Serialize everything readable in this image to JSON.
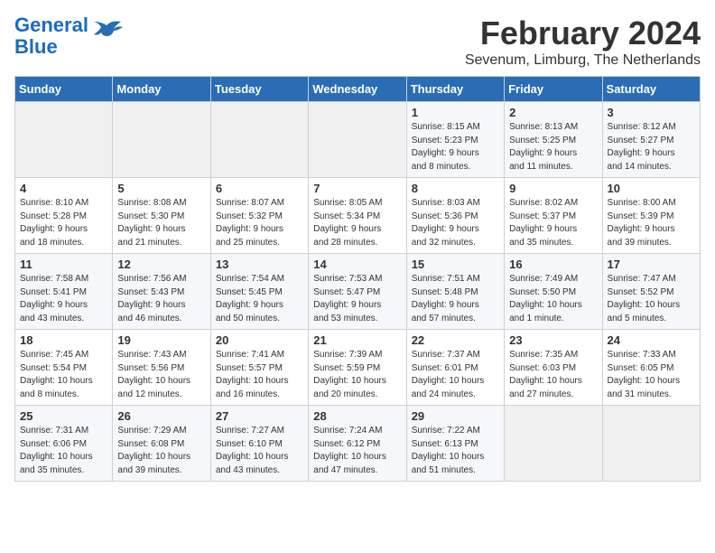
{
  "logo": {
    "part1": "General",
    "part2": "Blue"
  },
  "title": "February 2024",
  "location": "Sevenum, Limburg, The Netherlands",
  "days_of_week": [
    "Sunday",
    "Monday",
    "Tuesday",
    "Wednesday",
    "Thursday",
    "Friday",
    "Saturday"
  ],
  "weeks": [
    [
      {
        "day": "",
        "detail": ""
      },
      {
        "day": "",
        "detail": ""
      },
      {
        "day": "",
        "detail": ""
      },
      {
        "day": "",
        "detail": ""
      },
      {
        "day": "1",
        "detail": "Sunrise: 8:15 AM\nSunset: 5:23 PM\nDaylight: 9 hours\nand 8 minutes."
      },
      {
        "day": "2",
        "detail": "Sunrise: 8:13 AM\nSunset: 5:25 PM\nDaylight: 9 hours\nand 11 minutes."
      },
      {
        "day": "3",
        "detail": "Sunrise: 8:12 AM\nSunset: 5:27 PM\nDaylight: 9 hours\nand 14 minutes."
      }
    ],
    [
      {
        "day": "4",
        "detail": "Sunrise: 8:10 AM\nSunset: 5:28 PM\nDaylight: 9 hours\nand 18 minutes."
      },
      {
        "day": "5",
        "detail": "Sunrise: 8:08 AM\nSunset: 5:30 PM\nDaylight: 9 hours\nand 21 minutes."
      },
      {
        "day": "6",
        "detail": "Sunrise: 8:07 AM\nSunset: 5:32 PM\nDaylight: 9 hours\nand 25 minutes."
      },
      {
        "day": "7",
        "detail": "Sunrise: 8:05 AM\nSunset: 5:34 PM\nDaylight: 9 hours\nand 28 minutes."
      },
      {
        "day": "8",
        "detail": "Sunrise: 8:03 AM\nSunset: 5:36 PM\nDaylight: 9 hours\nand 32 minutes."
      },
      {
        "day": "9",
        "detail": "Sunrise: 8:02 AM\nSunset: 5:37 PM\nDaylight: 9 hours\nand 35 minutes."
      },
      {
        "day": "10",
        "detail": "Sunrise: 8:00 AM\nSunset: 5:39 PM\nDaylight: 9 hours\nand 39 minutes."
      }
    ],
    [
      {
        "day": "11",
        "detail": "Sunrise: 7:58 AM\nSunset: 5:41 PM\nDaylight: 9 hours\nand 43 minutes."
      },
      {
        "day": "12",
        "detail": "Sunrise: 7:56 AM\nSunset: 5:43 PM\nDaylight: 9 hours\nand 46 minutes."
      },
      {
        "day": "13",
        "detail": "Sunrise: 7:54 AM\nSunset: 5:45 PM\nDaylight: 9 hours\nand 50 minutes."
      },
      {
        "day": "14",
        "detail": "Sunrise: 7:53 AM\nSunset: 5:47 PM\nDaylight: 9 hours\nand 53 minutes."
      },
      {
        "day": "15",
        "detail": "Sunrise: 7:51 AM\nSunset: 5:48 PM\nDaylight: 9 hours\nand 57 minutes."
      },
      {
        "day": "16",
        "detail": "Sunrise: 7:49 AM\nSunset: 5:50 PM\nDaylight: 10 hours\nand 1 minute."
      },
      {
        "day": "17",
        "detail": "Sunrise: 7:47 AM\nSunset: 5:52 PM\nDaylight: 10 hours\nand 5 minutes."
      }
    ],
    [
      {
        "day": "18",
        "detail": "Sunrise: 7:45 AM\nSunset: 5:54 PM\nDaylight: 10 hours\nand 8 minutes."
      },
      {
        "day": "19",
        "detail": "Sunrise: 7:43 AM\nSunset: 5:56 PM\nDaylight: 10 hours\nand 12 minutes."
      },
      {
        "day": "20",
        "detail": "Sunrise: 7:41 AM\nSunset: 5:57 PM\nDaylight: 10 hours\nand 16 minutes."
      },
      {
        "day": "21",
        "detail": "Sunrise: 7:39 AM\nSunset: 5:59 PM\nDaylight: 10 hours\nand 20 minutes."
      },
      {
        "day": "22",
        "detail": "Sunrise: 7:37 AM\nSunset: 6:01 PM\nDaylight: 10 hours\nand 24 minutes."
      },
      {
        "day": "23",
        "detail": "Sunrise: 7:35 AM\nSunset: 6:03 PM\nDaylight: 10 hours\nand 27 minutes."
      },
      {
        "day": "24",
        "detail": "Sunrise: 7:33 AM\nSunset: 6:05 PM\nDaylight: 10 hours\nand 31 minutes."
      }
    ],
    [
      {
        "day": "25",
        "detail": "Sunrise: 7:31 AM\nSunset: 6:06 PM\nDaylight: 10 hours\nand 35 minutes."
      },
      {
        "day": "26",
        "detail": "Sunrise: 7:29 AM\nSunset: 6:08 PM\nDaylight: 10 hours\nand 39 minutes."
      },
      {
        "day": "27",
        "detail": "Sunrise: 7:27 AM\nSunset: 6:10 PM\nDaylight: 10 hours\nand 43 minutes."
      },
      {
        "day": "28",
        "detail": "Sunrise: 7:24 AM\nSunset: 6:12 PM\nDaylight: 10 hours\nand 47 minutes."
      },
      {
        "day": "29",
        "detail": "Sunrise: 7:22 AM\nSunset: 6:13 PM\nDaylight: 10 hours\nand 51 minutes."
      },
      {
        "day": "",
        "detail": ""
      },
      {
        "day": "",
        "detail": ""
      }
    ]
  ]
}
